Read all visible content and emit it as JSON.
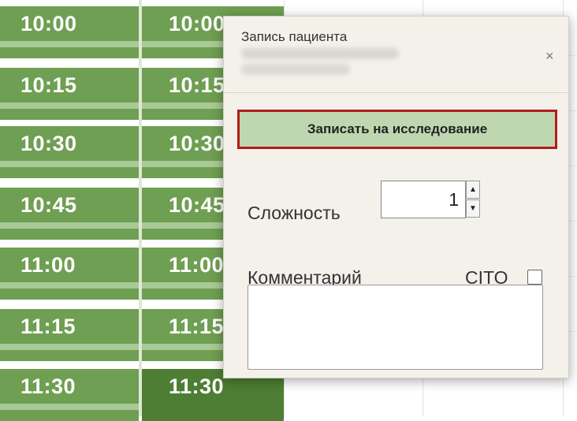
{
  "schedule": {
    "col1": [
      "10:00",
      "10:15",
      "10:30",
      "10:45",
      "11:00",
      "11:15",
      "11:30"
    ],
    "col2": [
      "10:00",
      "10:15",
      "10:30",
      "10:45",
      "11:00",
      "11:15",
      "11:30"
    ]
  },
  "popup": {
    "title": "Запись пациента",
    "close_icon": "×",
    "book_button": "Записать на исследование",
    "complexity_label": "Сложность",
    "complexity_value": "1",
    "spin_up": "▲",
    "spin_down": "▼",
    "comment_label": "Комментарий",
    "cito_label": "CITO"
  },
  "colors": {
    "slot_green": "#6f9f52",
    "slot_selected": "#4e7e34",
    "highlight_border": "#b31b1b"
  }
}
